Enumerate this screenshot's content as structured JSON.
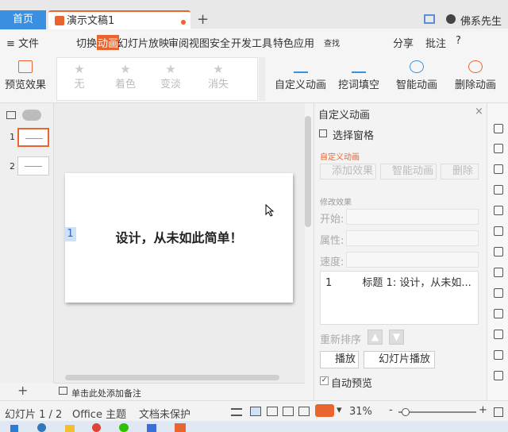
{
  "window": {
    "tabs": [
      {
        "label": "首页"
      },
      {
        "label": "演示文稿1"
      }
    ],
    "new_tab": "+",
    "user": "佛系先生"
  },
  "menu": {
    "file": "≡ 文件",
    "items": [
      "切换",
      "动画",
      "幻灯片放映",
      "审阅",
      "视图",
      "安全",
      "开发工具",
      "特色应用"
    ],
    "search": "查找",
    "share": "分享",
    "annotate": "批注",
    "help": "?"
  },
  "ribbon": {
    "preview": "预览效果",
    "gallery": [
      "无",
      "着色",
      "变淡",
      "消失"
    ],
    "custom_anim": "自定义动画",
    "cutout_fill": "挖词填空",
    "smart_anim": "智能动画",
    "delete_anim": "删除动画"
  },
  "thumbnails": [
    {
      "num": "1"
    },
    {
      "num": "2"
    }
  ],
  "slide": {
    "title": "设计，从未如此简单！",
    "placeholder_num": "1"
  },
  "notes_hint": "单击此处添加备注",
  "right_panel": {
    "header": "自定义动画",
    "selection_pane": "选择窗格",
    "section_custom": "自定义动画",
    "add_effect": "添加效果",
    "smart_anim": "智能动画",
    "delete": "删除",
    "modify_label": "修改效果",
    "start_label": "开始:",
    "property_label": "属性:",
    "speed_label": "速度:",
    "effect_item": "标题 1: 设计，从未如...",
    "effect_num": "1",
    "reorder_label": "重新排序",
    "play_btn": "播放",
    "slideshow_btn": "幻灯片播放",
    "auto_preview": "自动预览"
  },
  "status": {
    "slide_count": "幻灯片 1 / 2",
    "theme": "Office 主题",
    "protect": "文档未保护",
    "zoom": "31%",
    "zoom_minus": "-",
    "zoom_plus": "+"
  },
  "colors": {
    "accent": "#e9642e",
    "blue": "#3b8fe0"
  }
}
